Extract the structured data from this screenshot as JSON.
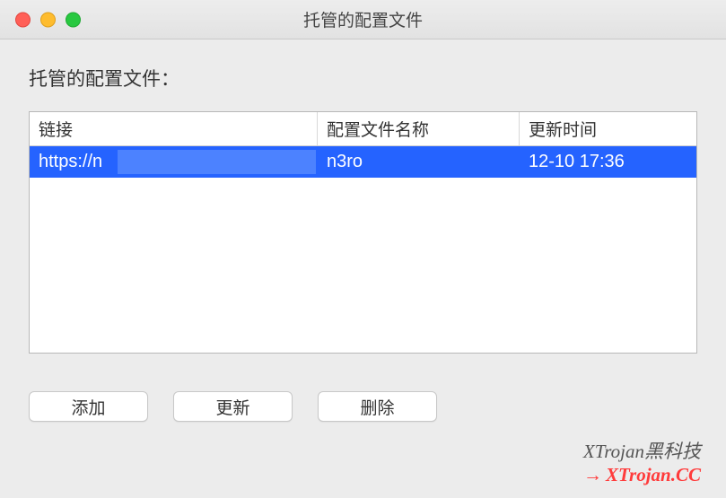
{
  "window": {
    "title": "托管的配置文件"
  },
  "section": {
    "label": "托管的配置文件："
  },
  "table": {
    "headers": {
      "url": "链接",
      "name": "配置文件名称",
      "time": "更新时间"
    },
    "rows": [
      {
        "url": "https://n",
        "name": "n3ro",
        "time": "12-10 17:36",
        "selected": true
      }
    ]
  },
  "buttons": {
    "add": "添加",
    "update": "更新",
    "delete": "删除"
  },
  "watermark": {
    "line1": "XTrojan黑科技",
    "arrow": "→",
    "line2": "XTrojan.CC"
  }
}
